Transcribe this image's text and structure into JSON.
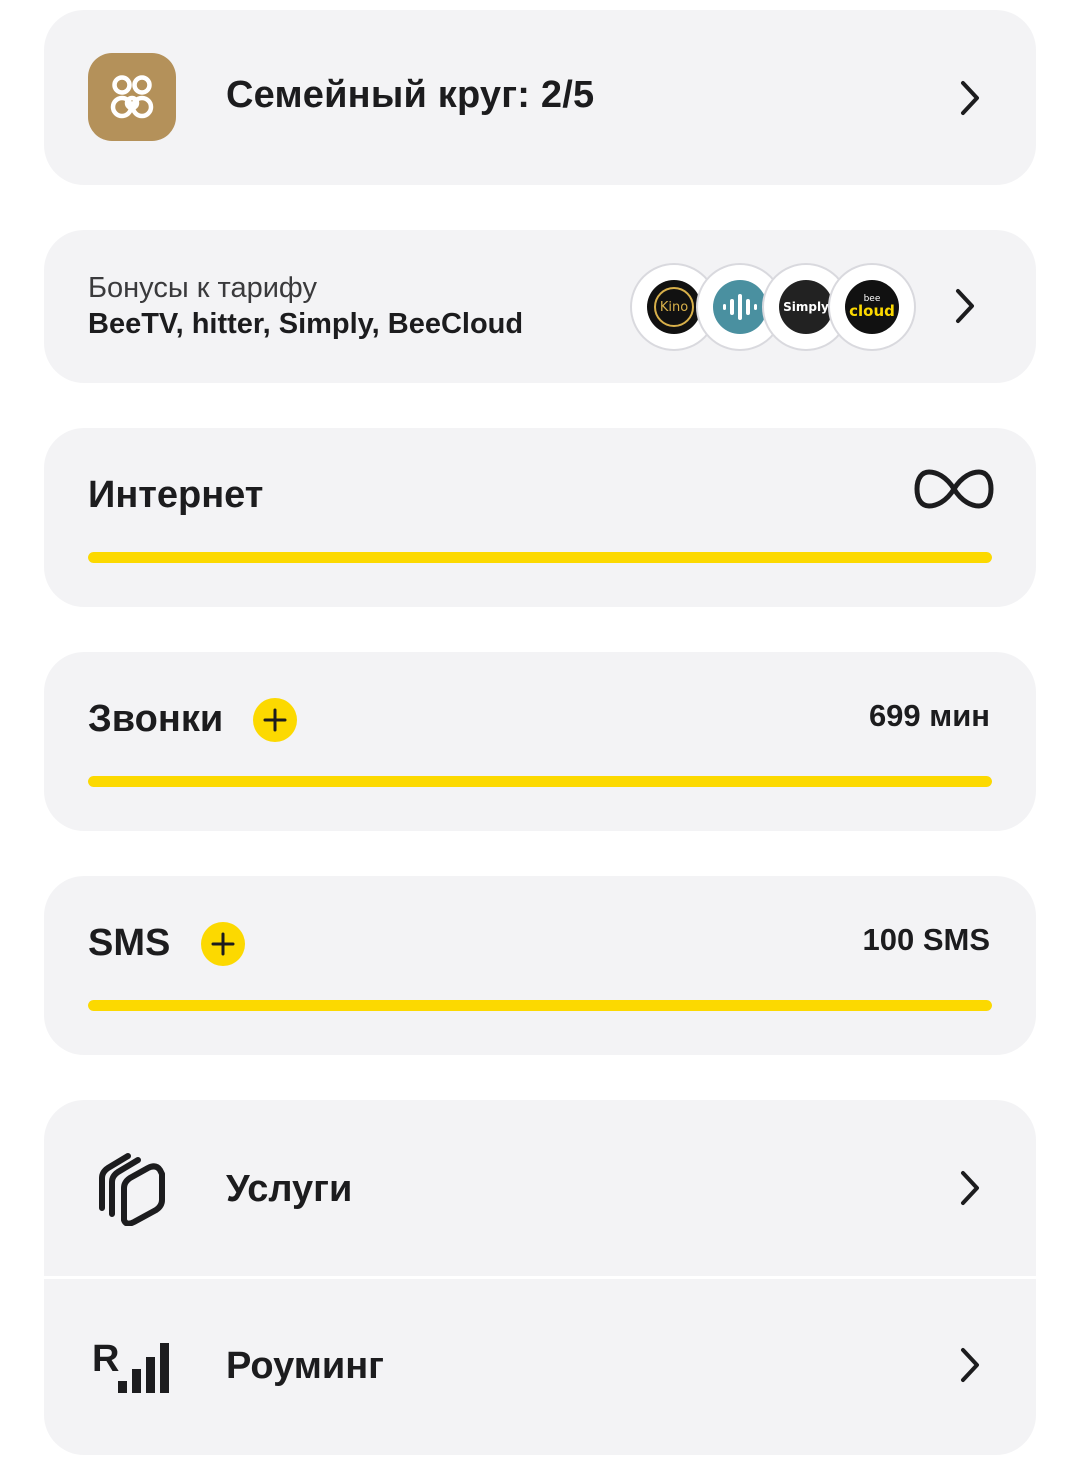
{
  "family": {
    "title": "Семейный круг: 2/5",
    "icon": "family-circle-icon",
    "icon_color": "#b4915a"
  },
  "bonuses": {
    "subtitle": "Бонусы к тарифу",
    "list": "BeeTV, hitter, Simply, BeeCloud",
    "logos": [
      {
        "name": "kino-logo",
        "text": "Kino"
      },
      {
        "name": "hitter-logo",
        "text": ""
      },
      {
        "name": "simply-logo",
        "text": "Simply"
      },
      {
        "name": "beecloud-logo",
        "text_top": "bee",
        "text_bottom": "cloud"
      }
    ]
  },
  "internet": {
    "label": "Интернет",
    "value_icon": "infinity-icon",
    "progress": 1.0
  },
  "calls": {
    "label": "Звонки",
    "value": "699 мин",
    "progress": 1.0
  },
  "sms": {
    "label": "SMS",
    "value": "100 SMS",
    "progress": 1.0
  },
  "links": [
    {
      "label": "Услуги",
      "icon": "services-icon"
    },
    {
      "label": "Роуминг",
      "icon": "roaming-icon"
    }
  ],
  "colors": {
    "accent": "#fcd900",
    "card_bg": "#f3f3f5",
    "text": "#1c1c1e"
  }
}
